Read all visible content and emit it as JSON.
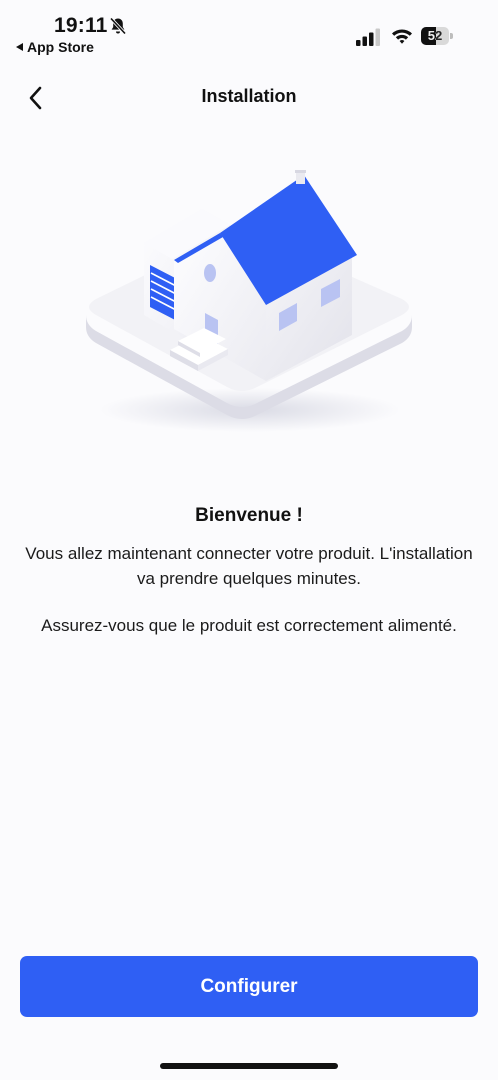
{
  "status_bar": {
    "time": "19:11",
    "back_app_label": "App Store",
    "battery_level": "52",
    "battery_fraction": 0.52,
    "icons": [
      "bell-slash-icon",
      "cellular-signal-icon",
      "wifi-icon",
      "battery-icon"
    ]
  },
  "nav": {
    "title": "Installation",
    "back_icon": "chevron-left-icon"
  },
  "illustration": {
    "subject": "house-icon",
    "colors": {
      "accent": "#2f5ff4",
      "wall": "#f2f2f6",
      "platform": "#ececf1"
    }
  },
  "content": {
    "title": "Bienvenue !",
    "paragraph_1": "Vous allez maintenant connecter votre produit. L'installation va prendre quelques minutes.",
    "paragraph_2": "Assurez-vous que le produit est correctement alimenté."
  },
  "actions": {
    "primary_label": "Configurer",
    "primary_color": "#2f5ff4"
  }
}
